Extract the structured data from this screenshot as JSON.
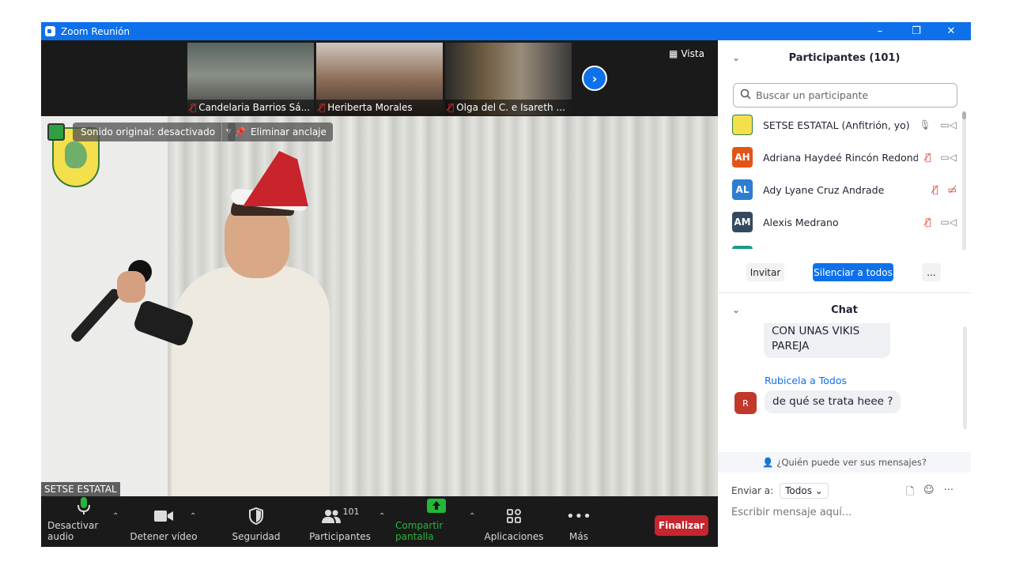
{
  "window": {
    "title": "Zoom Reunión",
    "minimize_glyph": "–",
    "restore_glyph": "❐",
    "close_glyph": "✕"
  },
  "thumbnails": [
    {
      "name": "Candelaria Barrios Sá...",
      "muted": true
    },
    {
      "name": "Heriberta Morales",
      "muted": true
    },
    {
      "name": "Olga del C. e Isareth ...",
      "muted": true
    }
  ],
  "next_page_glyph": "›",
  "view_label": "Vista",
  "main_video": {
    "sound_label": "Sonido original: desactivado",
    "unpin_label": "Eliminar anclaje",
    "speaker_name": "SETSE ESTATAL"
  },
  "toolbar": {
    "audio": "Desactivar audio",
    "video": "Detener vídeo",
    "security": "Seguridad",
    "participants": "Participantes",
    "participants_count": "101",
    "share": "Compartir pantalla",
    "apps": "Aplicaciones",
    "more": "Más",
    "end": "Finalizar"
  },
  "participants_panel": {
    "title": "Participantes (101)",
    "search_placeholder": "Buscar un participante",
    "rows": [
      {
        "initials": "",
        "name": "SETSE ESTATAL (Anfitrión, yo)",
        "color": "#ffffff"
      },
      {
        "initials": "AH",
        "name": "Adriana Haydeé Rincón Redonda",
        "color": "#e2541a"
      },
      {
        "initials": "AL",
        "name": "Ady Lyane Cruz Andrade",
        "color": "#2d7dd2"
      },
      {
        "initials": "AM",
        "name": "Alexis Medrano",
        "color": "#334a5e"
      }
    ],
    "invite_label": "Invitar",
    "mute_all_label": "Silenciar a todos",
    "more_label": "..."
  },
  "chat": {
    "title": "Chat",
    "prev_message": "CON UNAS VIKIS PAREJA",
    "sender_line": "Rubicela a Todos",
    "sender_initial": "R",
    "message": "de qué se trata heee ?",
    "who_can_see": "¿Quién puede ver sus mensajes?",
    "send_to_label": "Enviar a:",
    "send_to_value": "Todos",
    "input_placeholder": "Escribir mensaje aquí..."
  },
  "colors": {
    "zoom_blue": "#0e71eb",
    "end_red": "#c6262e",
    "mute_red": "#e3342f",
    "share_green": "#25b63a"
  }
}
